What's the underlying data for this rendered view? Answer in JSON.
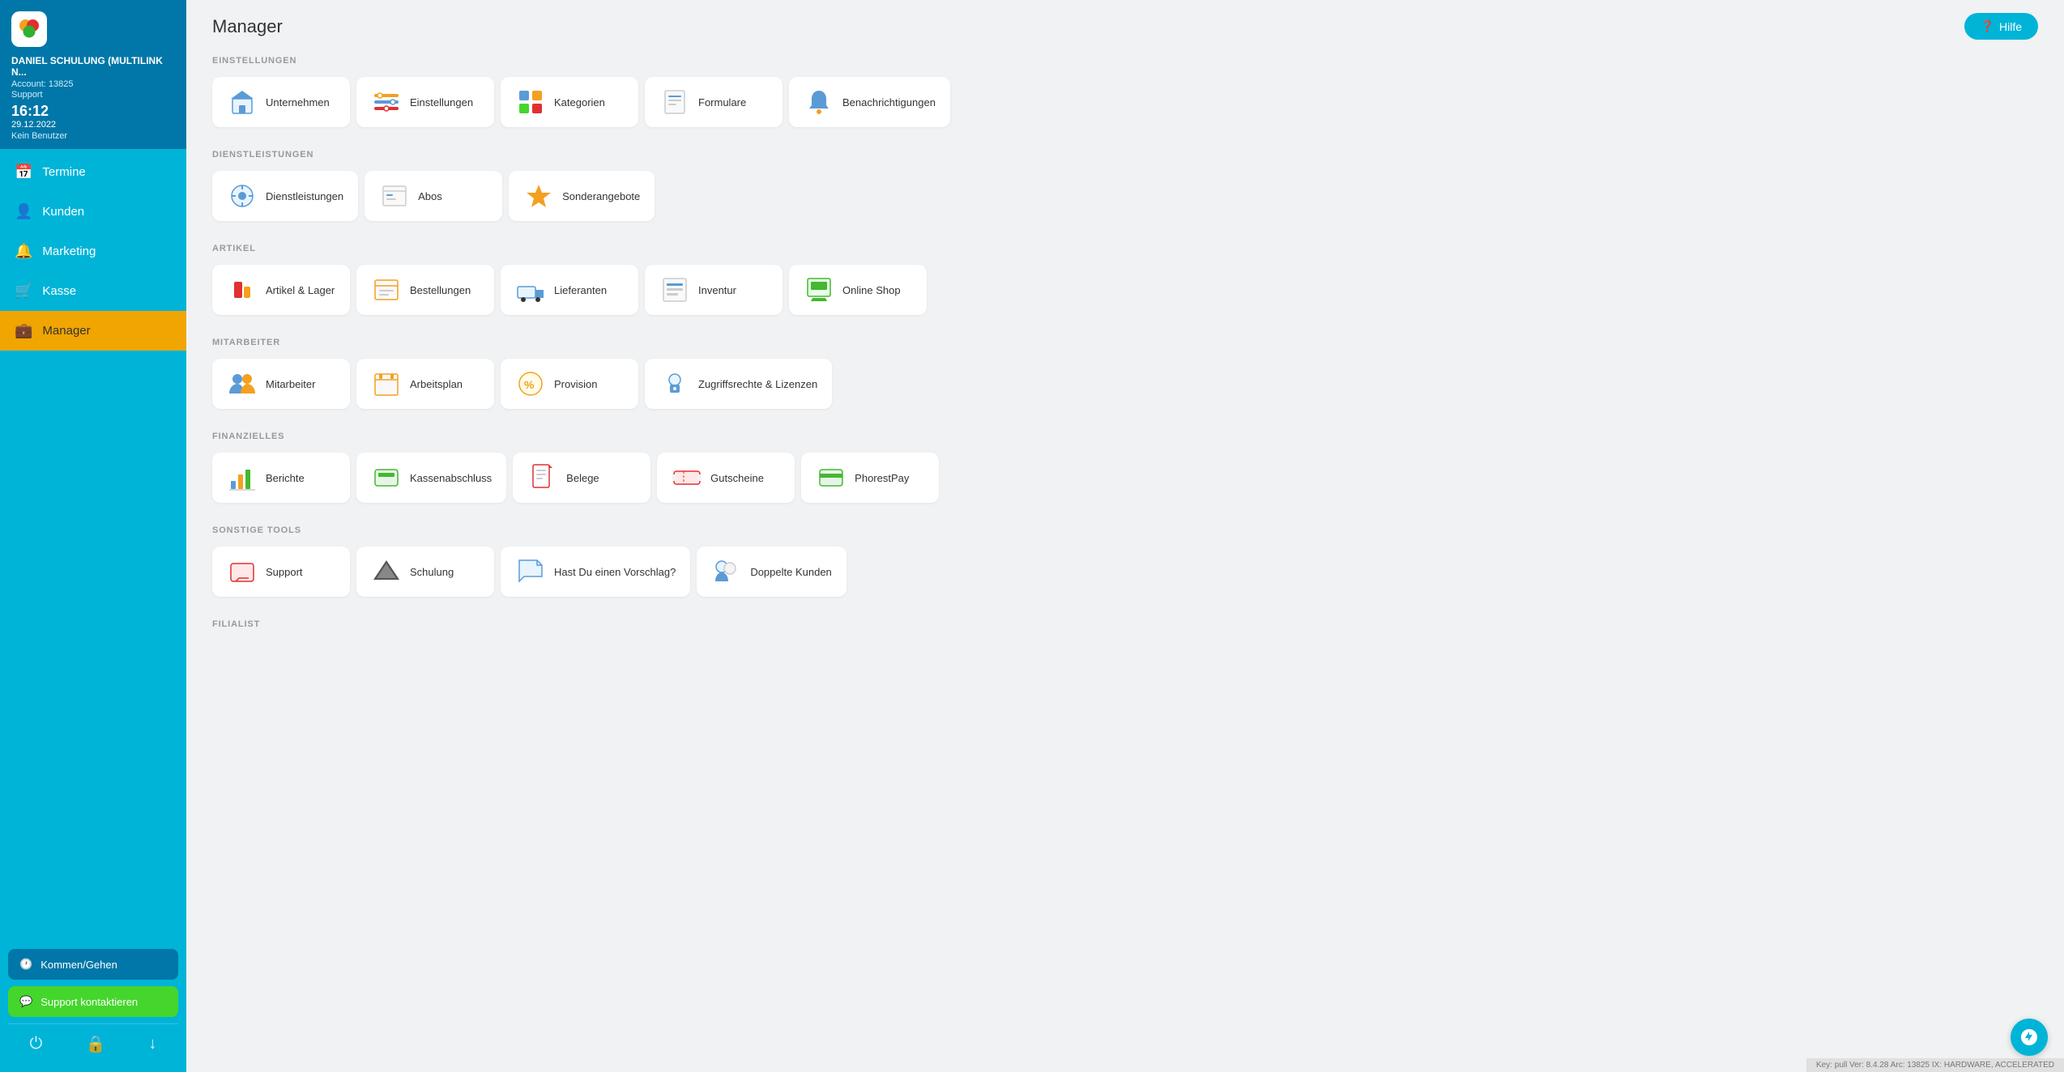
{
  "app": {
    "title": "Manager",
    "hilfe_label": "Hilfe",
    "version": "Key: pull Ver: 8.4.28 Arc: 13825 IX: HARDWARE, ACCELERATED"
  },
  "sidebar": {
    "user_name": "DANIEL SCHULUNG (MULTILINK N...",
    "account_label": "Account: 13825",
    "support_label": "Support",
    "time": "16:12",
    "date": "29.12.2022",
    "no_user": "Kein Benutzer",
    "nav_items": [
      {
        "id": "termine",
        "label": "Termine",
        "icon": "📅"
      },
      {
        "id": "kunden",
        "label": "Kunden",
        "icon": "👤"
      },
      {
        "id": "marketing",
        "label": "Marketing",
        "icon": "🔔"
      },
      {
        "id": "kasse",
        "label": "Kasse",
        "icon": "🛒"
      },
      {
        "id": "manager",
        "label": "Manager",
        "icon": "💼",
        "active": true
      }
    ],
    "kommen_label": "Kommen/Gehen",
    "support_btn_label": "Support kontaktieren"
  },
  "sections": [
    {
      "id": "einstellungen",
      "title": "EINSTELLUNGEN",
      "items": [
        {
          "id": "unternehmen",
          "label": "Unternehmen",
          "icon_type": "unternehmen"
        },
        {
          "id": "einstellungen",
          "label": "Einstellungen",
          "icon_type": "einstellungen"
        },
        {
          "id": "kategorien",
          "label": "Kategorien",
          "icon_type": "kategorien"
        },
        {
          "id": "formulare",
          "label": "Formulare",
          "icon_type": "formulare"
        },
        {
          "id": "benachrichtigungen",
          "label": "Benachrichtigungen",
          "icon_type": "benachrichtigungen"
        }
      ]
    },
    {
      "id": "dienstleistungen",
      "title": "DIENSTLEISTUNGEN",
      "items": [
        {
          "id": "dienstleistungen",
          "label": "Dienstleistungen",
          "icon_type": "dienstleistungen"
        },
        {
          "id": "abos",
          "label": "Abos",
          "icon_type": "abos"
        },
        {
          "id": "sonderangebote",
          "label": "Sonderangebote",
          "icon_type": "sonderangebote"
        }
      ]
    },
    {
      "id": "artikel",
      "title": "ARTIKEL",
      "items": [
        {
          "id": "artikel-lager",
          "label": "Artikel & Lager",
          "icon_type": "artikel"
        },
        {
          "id": "bestellungen",
          "label": "Bestellungen",
          "icon_type": "bestellungen"
        },
        {
          "id": "lieferanten",
          "label": "Lieferanten",
          "icon_type": "lieferanten"
        },
        {
          "id": "inventur",
          "label": "Inventur",
          "icon_type": "inventur"
        },
        {
          "id": "online-shop",
          "label": "Online Shop",
          "icon_type": "onlineshop"
        }
      ]
    },
    {
      "id": "mitarbeiter",
      "title": "MITARBEITER",
      "items": [
        {
          "id": "mitarbeiter",
          "label": "Mitarbeiter",
          "icon_type": "mitarbeiter"
        },
        {
          "id": "arbeitsplan",
          "label": "Arbeitsplan",
          "icon_type": "arbeitsplan"
        },
        {
          "id": "provision",
          "label": "Provision",
          "icon_type": "provision"
        },
        {
          "id": "zugriffsrechte",
          "label": "Zugriffsrechte & Lizenzen",
          "icon_type": "zugriffsrechte"
        }
      ]
    },
    {
      "id": "finanzielles",
      "title": "FINANZIELLES",
      "items": [
        {
          "id": "berichte",
          "label": "Berichte",
          "icon_type": "berichte"
        },
        {
          "id": "kassenabschluss",
          "label": "Kassenabschluss",
          "icon_type": "kassenabschluss"
        },
        {
          "id": "belege",
          "label": "Belege",
          "icon_type": "belege"
        },
        {
          "id": "gutscheine",
          "label": "Gutscheine",
          "icon_type": "gutscheine"
        },
        {
          "id": "phorestpay",
          "label": "PhorestPay",
          "icon_type": "phorestpay"
        }
      ]
    },
    {
      "id": "sonstige-tools",
      "title": "SONSTIGE TOOLS",
      "items": [
        {
          "id": "support",
          "label": "Support",
          "icon_type": "support"
        },
        {
          "id": "schulung",
          "label": "Schulung",
          "icon_type": "schulung"
        },
        {
          "id": "vorschlag",
          "label": "Hast Du einen Vorschlag?",
          "icon_type": "vorschlag"
        },
        {
          "id": "doppelte-kunden",
          "label": "Doppelte Kunden",
          "icon_type": "doppeltekunden"
        }
      ]
    },
    {
      "id": "filialist",
      "title": "FILIALIST",
      "items": []
    }
  ]
}
